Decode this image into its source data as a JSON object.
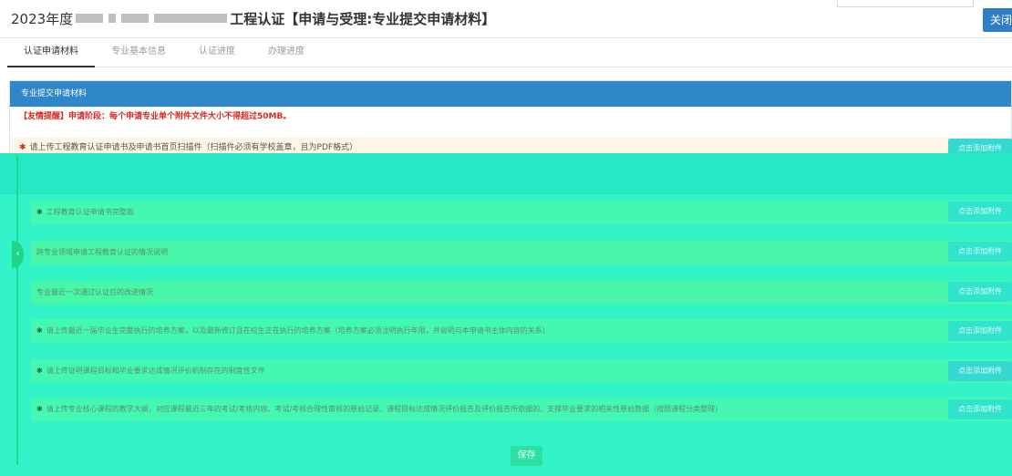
{
  "header": {
    "title_year": "2023年度",
    "title_main": "工程认证【申请与受理:专业提交申请材料】",
    "close_label": "关闭"
  },
  "tabs": [
    {
      "label": "认证申请材料",
      "active": true
    },
    {
      "label": "专业基本信息",
      "active": false
    },
    {
      "label": "认证进度",
      "active": false
    },
    {
      "label": "办理进度",
      "active": false
    }
  ],
  "panel": {
    "heading": "专业提交申请材料",
    "notice": "【友情提醒】申请阶段：每个申请专业单个附件文件大小不得超过50MB。"
  },
  "materials": [
    {
      "required": true,
      "label": "请上传工程教育认证申请书及申请书首页扫描件（扫描件必须有学校盖章，且为PDF格式）",
      "button": "点击添加附件"
    },
    {
      "required": true,
      "label": "工程教育认证申请书完整版",
      "button": "点击添加附件"
    },
    {
      "required": false,
      "label": "跨专业领域申请工程教育认证的情况说明",
      "button": "点击添加附件"
    },
    {
      "required": false,
      "label": "专业最近一次通过认证后的改进情况",
      "button": "点击添加附件"
    },
    {
      "required": true,
      "label": "请上传最近一届毕业生完整执行的培养方案，以及最新修订且在校生正在执行的培养方案（培养方案必须注明执行年限，并说明与本申请书主体内容的关系）",
      "button": "点击添加附件"
    },
    {
      "required": true,
      "label": "请上传证明课程目标和毕业要求达成情况评价机制存在的制度性文件",
      "button": "点击添加附件"
    },
    {
      "required": true,
      "label": "请上传专业核心课程的教学大纲，对应课程最近三年的考试/考核内容、考试/考核合理性审核的原始记录、课程目标达成情况评价报告及评价报告所依据的、支撑毕业要求的相关性原始数据（按照课程分类整理）",
      "button": "点击添加附件"
    }
  ],
  "footer": {
    "save_label": "保存"
  },
  "colors": {
    "accent_blue": "#2f86c8",
    "notice_red": "#d9281f",
    "overlay_green": "#33f3c8"
  }
}
